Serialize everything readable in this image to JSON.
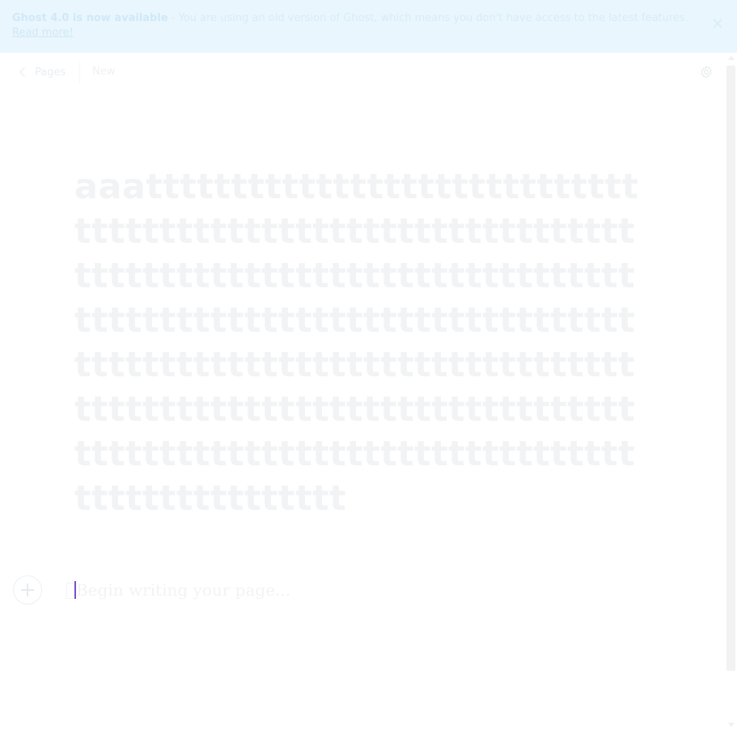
{
  "banner": {
    "headline": "Ghost 4.0 is now available",
    "message": " - You are using an old version of Ghost, which means you don't have access to the latest features. ",
    "link": "Read more!"
  },
  "topbar": {
    "back_label": "Pages",
    "status": "New"
  },
  "editor": {
    "title": "aaattttttttttttttttttttttttttttttttttttttttttttttttttttttttttttttttttttttttttttttttttttttttttttttttttttttttttttttttttttttttttttttttttttttttttttttttttttttttttttttttttttttttttttttttttttttttttttttttttttttttttttttttttttttttttttttttttttttttttttttttttt",
    "placeholder": "Begin writing your page..."
  },
  "colors": {
    "banner_bg": "#eaf6fd",
    "caret": "#7b4fd4"
  },
  "icons": {
    "back": "chevron-left-icon",
    "settings": "gear-icon",
    "add": "plus-icon",
    "close": "close-icon"
  }
}
